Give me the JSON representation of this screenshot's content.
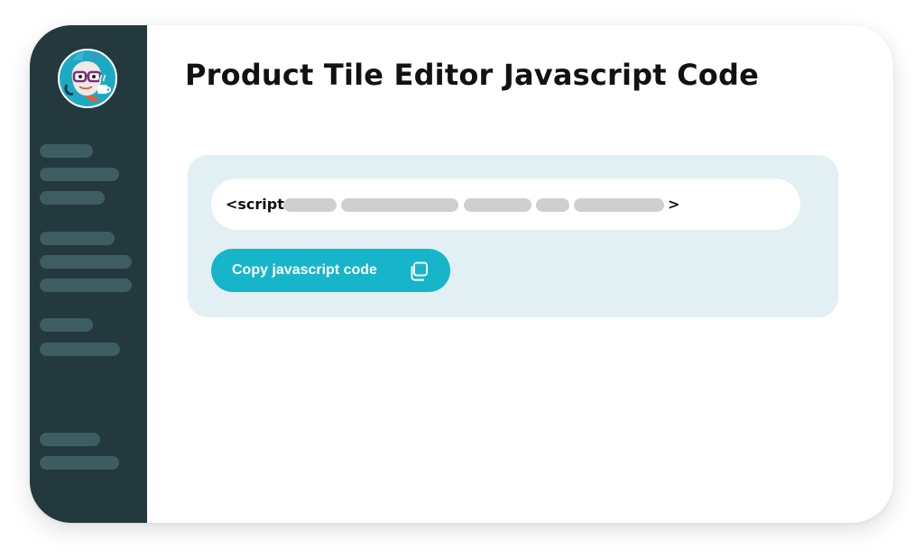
{
  "page": {
    "title": "Product Tile Editor Javascript Code"
  },
  "sidebar": {
    "logo_icon": "mascot-logo-icon"
  },
  "code_snippet": {
    "open_tag": "<script",
    "close_tag": ">"
  },
  "copy_button": {
    "label": "Copy javascript code",
    "icon": "copy-icon"
  },
  "colors": {
    "sidebar": "#23393d",
    "sidebar_placeholder": "#3e5d62",
    "panel": "#e2f0f3",
    "accent": "#17b5c9"
  }
}
